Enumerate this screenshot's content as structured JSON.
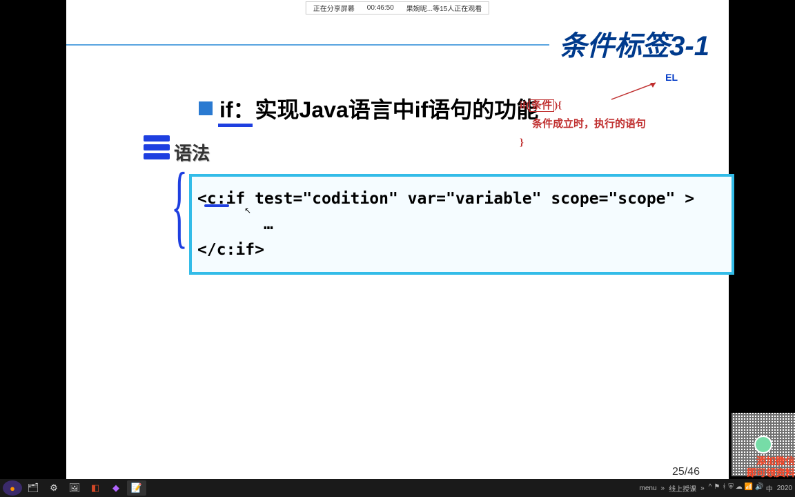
{
  "share": {
    "status": "正在分享屏幕",
    "time": "00:46:50",
    "viewers": "果婉昵...等15人正在观看"
  },
  "title": "条件标签3-1",
  "bullet": "if：实现Java语言中if语句的功能",
  "syntax_label": "语法",
  "code": {
    "line1": "<c:if   test=\"codition\"   var=\"variable\"  scope=\"scope\" >",
    "line2": "…",
    "line3": "</c:if>"
  },
  "el": {
    "label": "EL",
    "if_open": "if(",
    "condition": "条件",
    "if_close": "){",
    "body": "条件成立时，执行的语句",
    "close_brace": "}"
  },
  "page": "25/46",
  "qr": {
    "line1": "添加微信",
    "line2": "即可领资料"
  },
  "taskbar": {
    "menu": "menu",
    "status": "线上授课",
    "year": "2020"
  }
}
